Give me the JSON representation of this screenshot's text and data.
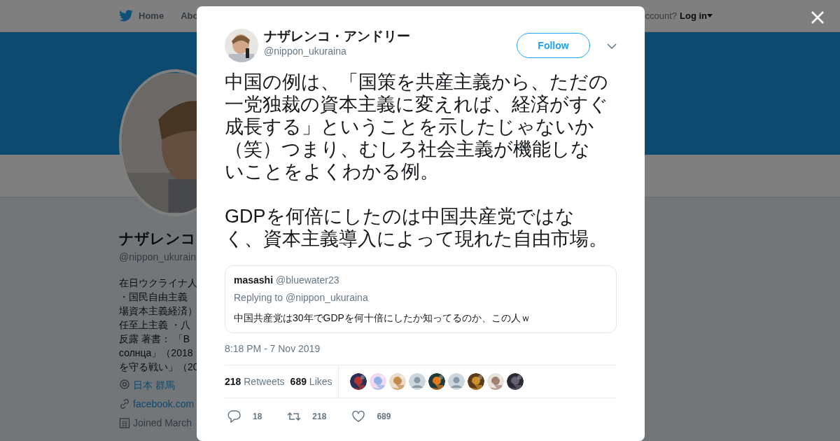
{
  "background_page": {
    "nav": {
      "items": [
        "Home",
        "Abo"
      ],
      "account_prompt": "ccount?",
      "login": "Log in"
    },
    "profile": {
      "name": "ナザレンコ",
      "handle": "@nippon_ukurain",
      "bio_lines": [
        "在日ウクライナ人",
        "・国民自由主義",
        "場資本主義経済）",
        "任至上主義 ・八",
        "反露 著書： 「В",
        "солнца」（2018",
        "を守る戦い」（20"
      ],
      "location": "日本 群馬",
      "link": "facebook.com",
      "joined": "Joined March"
    }
  },
  "tweet": {
    "author": {
      "name": "ナザレンコ・アンドリー",
      "handle": "@nippon_ukuraina"
    },
    "follow_button": "Follow",
    "text_paragraphs": [
      "中国の例は、「国策を共産主義から、ただの一党独裁の資本主義に変えれば、経済がすぐ成長する」ということを示したじゃないか（笑）つまり、むしろ社会主義が機能しないことをよくわかる例。",
      "GDPを何倍にしたのは中国共産党ではなく、資本主義導入によって現れた自由市場。"
    ],
    "quoted": {
      "name": "masashi",
      "handle": "@bluewater23",
      "replying_to": "Replying to @nippon_ukuraina",
      "text": "中国共産党は30年でGDPを何十倍にしたか知ってるのか、この人ｗ"
    },
    "timestamp": "8:18 PM - 7 Nov 2019",
    "stats": [
      {
        "count": "218",
        "label": "Retweets"
      },
      {
        "count": "689",
        "label": "Likes"
      }
    ],
    "likers": [
      {
        "kind": "picture"
      },
      {
        "kind": "picture"
      },
      {
        "kind": "picture"
      },
      {
        "kind": "default"
      },
      {
        "kind": "picture"
      },
      {
        "kind": "default"
      },
      {
        "kind": "picture"
      },
      {
        "kind": "picture"
      },
      {
        "kind": "picture"
      }
    ],
    "actions": [
      {
        "kind": "reply",
        "count": "18"
      },
      {
        "kind": "retweet",
        "count": "218"
      },
      {
        "kind": "like",
        "count": "689"
      }
    ]
  }
}
